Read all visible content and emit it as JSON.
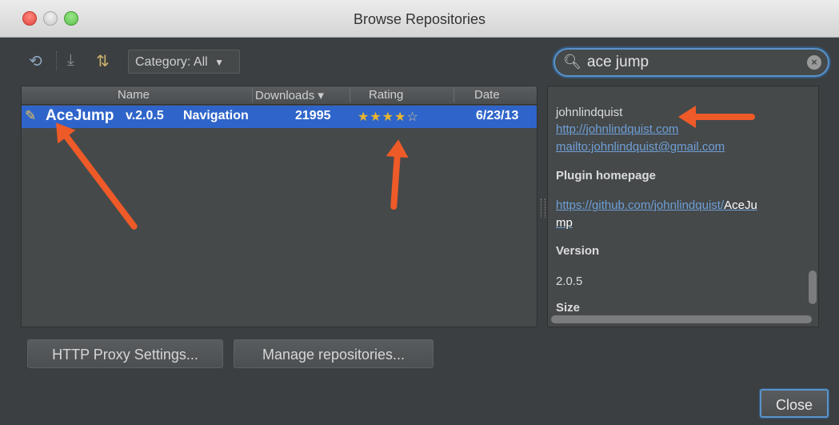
{
  "window": {
    "title": "Browse Repositories"
  },
  "toolbar": {
    "category_label": "Category: All"
  },
  "search": {
    "value": "ace jump",
    "clear_icon": "clear-icon"
  },
  "table": {
    "columns": [
      "Name",
      "Downloads",
      "Rating",
      "Date"
    ],
    "sort_indicator": "▾",
    "rows": [
      {
        "name": "AceJump",
        "version": "v.2.0.5",
        "category": "Navigation",
        "downloads": "21995",
        "rating_stars": 4,
        "date": "6/23/13"
      }
    ]
  },
  "details": {
    "author": "johnlindquist",
    "author_url": "http://johnlindquist.com",
    "author_email": "mailto:johnlindquist@gmail.com",
    "homepage_heading": "Plugin homepage",
    "homepage_url_part1": "https://github.com/johnlindquist/",
    "homepage_url_highlight1": "AceJu",
    "homepage_url_highlight2": "mp",
    "version_heading": "Version",
    "version_value": "2.0.5",
    "size_heading": "Size"
  },
  "buttons": {
    "proxy": "HTTP Proxy Settings...",
    "manage": "Manage repositories...",
    "close": "Close"
  },
  "colors": {
    "accent": "#2f65ca",
    "focus": "#5a93c9",
    "annotation_arrow": "#ee5a28"
  }
}
